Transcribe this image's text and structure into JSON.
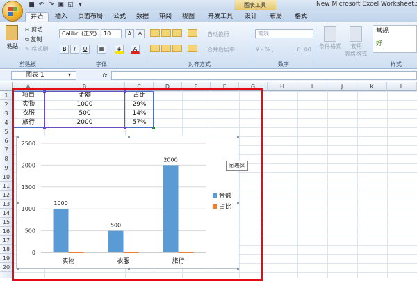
{
  "titlebar": {
    "tools_tab": "图表工具",
    "doc_title": "New Microsoft Excel Worksheet.xlsx"
  },
  "tabs": [
    "开始",
    "插入",
    "页面布局",
    "公式",
    "数据",
    "审阅",
    "视图",
    "开发工具",
    "设计",
    "布局",
    "格式"
  ],
  "ribbon": {
    "clipboard": {
      "paste": "粘贴",
      "cut": "剪切",
      "copy": "复制",
      "format_painter": "格式刷",
      "label": "剪贴板"
    },
    "font": {
      "name": "Calibri (正文)",
      "size": "10",
      "grow": "A",
      "shrink": "A",
      "bold": "B",
      "italic": "I",
      "underline": "U",
      "color": "A",
      "label": "字体"
    },
    "alignment": {
      "wrap": "自动换行",
      "merge": "合并后居中",
      "label": "对齐方式"
    },
    "number": {
      "format": "常规",
      "label": "数字"
    },
    "styles": {
      "conditional": "条件格式",
      "table": "套用",
      "table2": "表格格式",
      "normal": "常规",
      "good": "好",
      "label": "样式"
    }
  },
  "formula": {
    "namebox": "图表 1",
    "fx": "fx",
    "content": ""
  },
  "columns": [
    "A",
    "B",
    "C",
    "D",
    "E",
    "F",
    "G",
    "H",
    "I",
    "J",
    "K",
    "L"
  ],
  "rows": [
    "1",
    "2",
    "3",
    "4",
    "5",
    "6",
    "7",
    "8",
    "9",
    "10",
    "11",
    "12",
    "13",
    "14",
    "15",
    "16",
    "17",
    "18",
    "19",
    "20"
  ],
  "table": {
    "headers": [
      "项目",
      "金额",
      "占比"
    ],
    "rows": [
      [
        "实物",
        "1000",
        "29%"
      ],
      [
        "衣服",
        "500",
        "14%"
      ],
      [
        "旅行",
        "2000",
        "57%"
      ]
    ]
  },
  "tooltip": "图表区",
  "colors": {
    "series1": "#5b9bd5",
    "series2": "#ed7d31",
    "highlight": "#e30c15"
  },
  "chart_data": {
    "type": "bar",
    "categories": [
      "实物",
      "衣服",
      "旅行"
    ],
    "series": [
      {
        "name": "金额",
        "values": [
          1000,
          500,
          2000
        ]
      },
      {
        "name": "占比",
        "values": [
          0.29,
          0.14,
          0.57
        ]
      }
    ],
    "data_labels": [
      "1000",
      "500",
      "2000"
    ],
    "y_ticks": [
      "0",
      "500",
      "1000",
      "1500",
      "2000",
      "2500"
    ],
    "ylim": [
      0,
      2500
    ],
    "legend": "right",
    "grid": true
  }
}
